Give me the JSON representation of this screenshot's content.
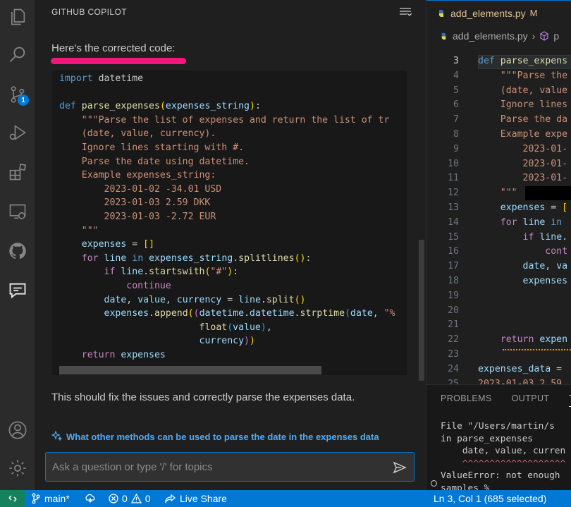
{
  "copilot": {
    "title": "GITHUB COPILOT",
    "intro": "Here's the corrected code:",
    "outro": "This should fix the issues and correctly parse the expenses data.",
    "followup": "What other methods can be used to parse the date in the expenses data",
    "input_placeholder": "Ask a question or type '/' for topics"
  },
  "editor": {
    "tab_name": "add_elements.py",
    "tab_modified": "M",
    "breadcrumb_file": "add_elements.py",
    "line_numbers": [
      "3",
      "4",
      "5",
      "6",
      "7",
      "8",
      "9",
      "10",
      "11",
      "12",
      "13",
      "14",
      "15",
      "16",
      "17",
      "18",
      "19",
      "20",
      "21",
      "22",
      "23",
      "24",
      "25"
    ],
    "current_line": "3"
  },
  "panel": {
    "tabs": [
      "PROBLEMS",
      "OUTPUT",
      "T"
    ],
    "terminal_lines": [
      "File \"/Users/martin/s",
      "in parse_expenses",
      "    date, value, curren",
      "    ^^^^^^^^^^^^^^^^^^^",
      "ValueError: not enough",
      "samples %"
    ]
  },
  "status": {
    "branch": "main*",
    "errors": "0",
    "warnings": "0",
    "live_share": "Live Share",
    "position": "Ln 3, Col 1 (685 selected)"
  },
  "activity": {
    "scm_badge": "1"
  },
  "colors": {
    "accent": "#0078d4",
    "highlight": "#f2167d",
    "remote": "#16825d"
  },
  "icons": [
    "explorer-icon",
    "search-icon",
    "source-control-icon",
    "run-debug-icon",
    "extensions-icon",
    "remote-explorer-icon",
    "github-icon",
    "chat-icon",
    "account-icon",
    "settings-gear-icon",
    "send-icon",
    "sparkle-icon",
    "branch-icon",
    "sync-icon",
    "error-icon",
    "warning-icon",
    "live-share-icon"
  ]
}
